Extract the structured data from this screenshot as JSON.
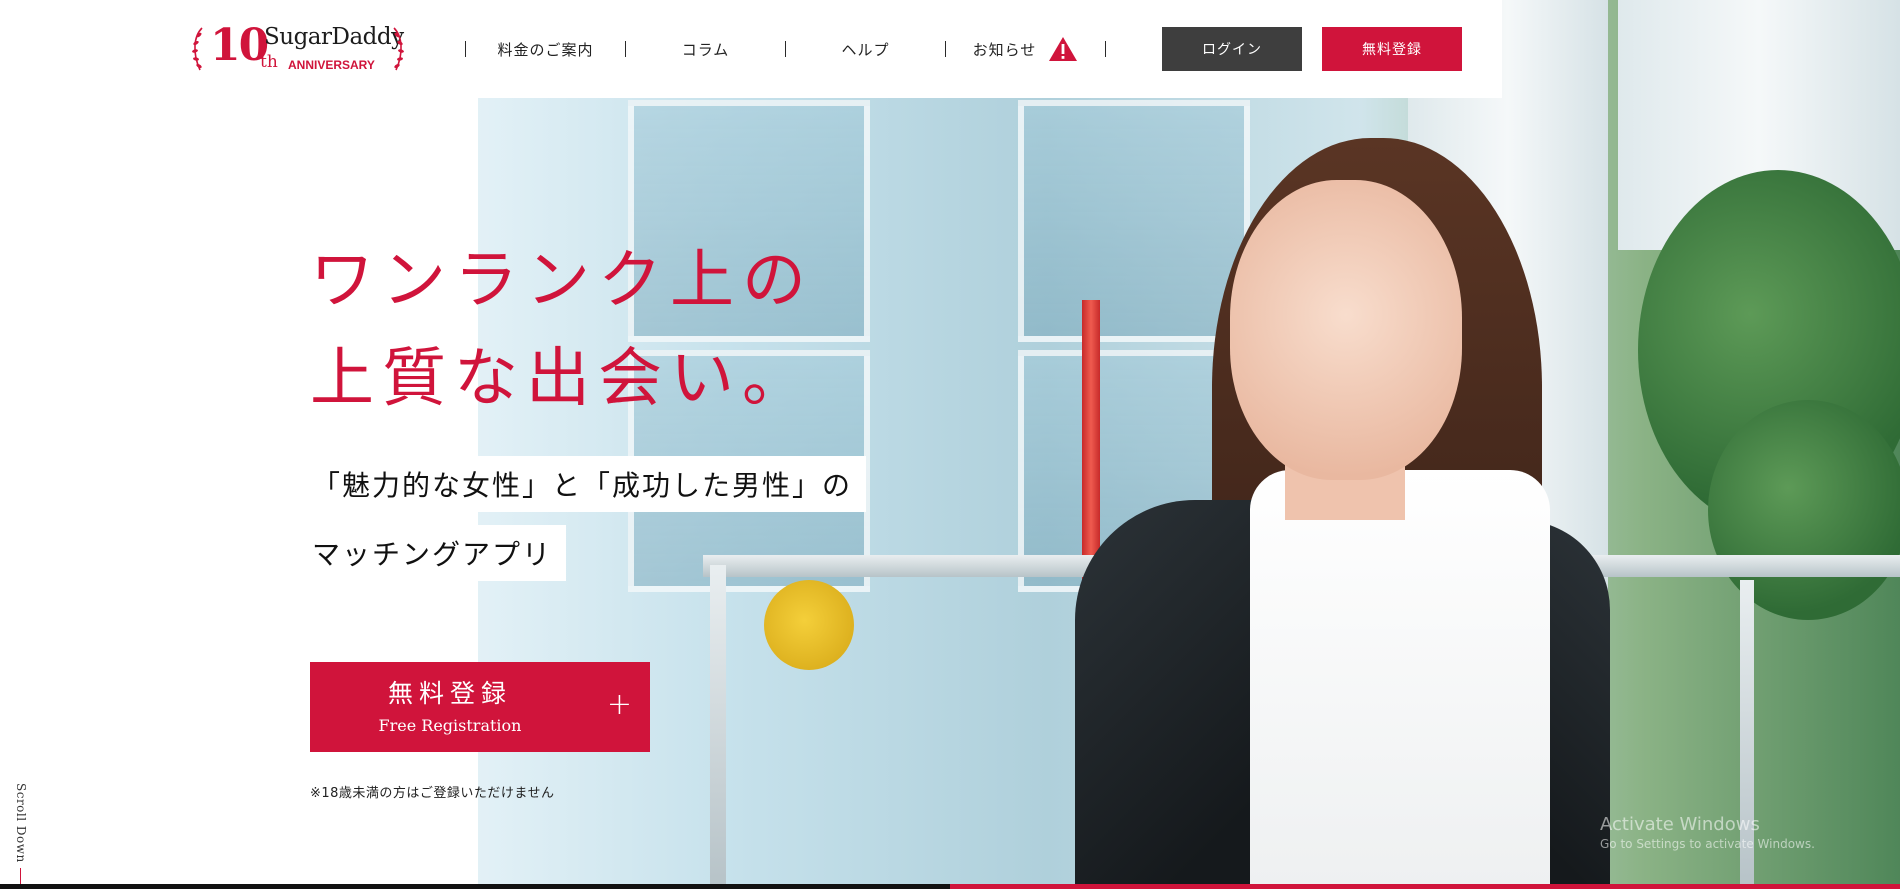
{
  "header": {
    "logo": {
      "number": "10",
      "suffix": "th",
      "brand": "SugarDaddy",
      "sub": "ANNIVERSARY"
    },
    "nav": [
      {
        "label": "料金のご案内"
      },
      {
        "label": "コラム"
      },
      {
        "label": "ヘルプ"
      },
      {
        "label": "お知らせ",
        "icon": "warning-icon"
      }
    ],
    "login_label": "ログイン",
    "register_label": "無料登録"
  },
  "hero": {
    "title_line1": "ワンランク上の",
    "title_line2": "上質な出会い。",
    "sub_line1": "「魅力的な女性」と「成功した男性」の",
    "sub_line2": "マッチングアプリ",
    "cta_ja": "無料登録",
    "cta_en": "Free Registration",
    "cta_icon": "plus-icon",
    "age_note": "※18歳未満の方はご登録いただけません"
  },
  "side": {
    "scroll_label": "Scroll Down"
  },
  "watermark": {
    "title": "Activate Windows",
    "sub": "Go to Settings to activate Windows."
  },
  "slider": {
    "progress": 0.5
  },
  "colors": {
    "brand_red": "#d0143b",
    "login_gray": "#3e3e3e",
    "progress_track": "#111111"
  }
}
